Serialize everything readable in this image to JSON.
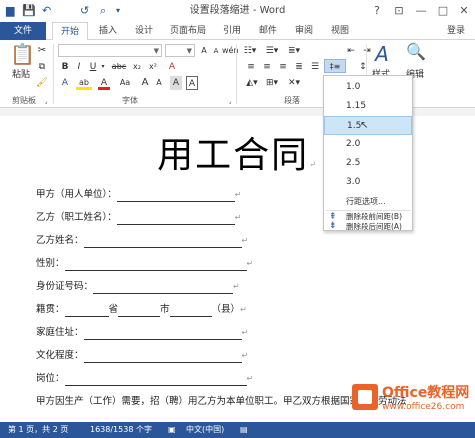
{
  "titlebar": {
    "title": "设置段落缩进 - Word",
    "help": "?",
    "ribbon_opts": "⊡",
    "minimize": "—",
    "maximize": "□",
    "close": "✕",
    "qa_save": "💾",
    "qa_undo": "↶",
    "qa_redo": "↺",
    "qa_preview": "⌕",
    "qa_more": "▾"
  },
  "tabs": [
    "文件",
    "开始",
    "插入",
    "设计",
    "页面布局",
    "引用",
    "邮件",
    "审阅",
    "视图"
  ],
  "login": "登录",
  "ribbon": {
    "paste_label": "粘贴",
    "clipboard_group": "剪贴板",
    "font_group": "字体",
    "paragraph_group": "段落",
    "styles_label": "样式",
    "editing_label": "编辑",
    "bold": "B",
    "italic": "I",
    "underline": "U",
    "strike": "abc",
    "subscript": "x₂",
    "superscript": "x²",
    "font_color": "A",
    "highlight": "ab",
    "grow_font": "A",
    "shrink_font": "A",
    "aa": "Aa",
    "char_border": "A",
    "wen": "wén",
    "clear_fmt": "A",
    "char_shade": "A",
    "line_spacing_icon": "‡≡"
  },
  "menu": {
    "items": [
      "1.0",
      "1.15",
      "1.5",
      "2.0",
      "2.5",
      "3.0"
    ],
    "selected_index": 2,
    "options": "行距选项...",
    "add_before": "删除段前间距(B)",
    "add_after": "删除段后间距(A)"
  },
  "document": {
    "title": "用工合同",
    "lines": [
      {
        "label": "甲方（用人单位）："
      },
      {
        "label": "乙方（职工姓名）："
      },
      {
        "label": "乙方姓名："
      },
      {
        "label": "性别："
      },
      {
        "label": "身份证号码："
      },
      {
        "label": "籍贯：",
        "p1": "省",
        "p2": "市",
        "p3": "（县）"
      },
      {
        "label": "家庭住址："
      },
      {
        "label": "文化程度："
      },
      {
        "label": "岗位："
      }
    ],
    "last_paragraph": "甲方因生产（工作）需要，招（聘）用乙方为本单位职工。甲乙双方根据国家有关劳动法"
  },
  "status": {
    "page": "第 1 页，共 2 页",
    "words": "1638/1538 个字",
    "lang": "中文(中国)"
  },
  "watermark": {
    "line1": "Office教程网",
    "line2": "www.office26.com"
  },
  "colors": {
    "accent": "#2b579a",
    "menu_highlight": "#cde6f7",
    "watermark": "#e9632a"
  }
}
